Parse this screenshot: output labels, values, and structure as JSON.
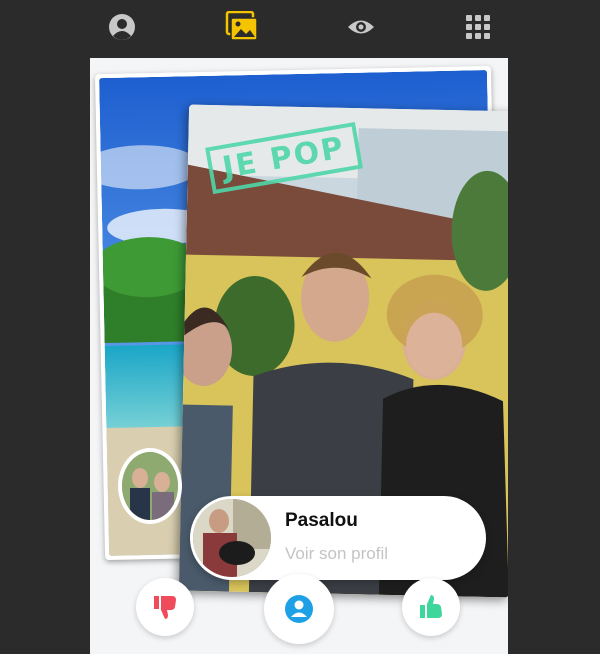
{
  "nav": {
    "items": [
      {
        "icon": "user-circle-icon",
        "active": false
      },
      {
        "icon": "photos-icon",
        "active": true
      },
      {
        "icon": "eye-icon",
        "active": false
      },
      {
        "icon": "grid-menu-icon",
        "active": false
      }
    ],
    "active_color": "#f5c400",
    "inactive_color": "#c8c8c8"
  },
  "card": {
    "stamp_text": "JE POP",
    "stamp_color": "#4fd6a8"
  },
  "profile": {
    "name": "Pasalou",
    "link_text": "Voir son profil"
  },
  "actions": {
    "dislike_color": "#ef4b5b",
    "profile_color": "#1ea0e6",
    "like_color": "#3ed69a"
  }
}
